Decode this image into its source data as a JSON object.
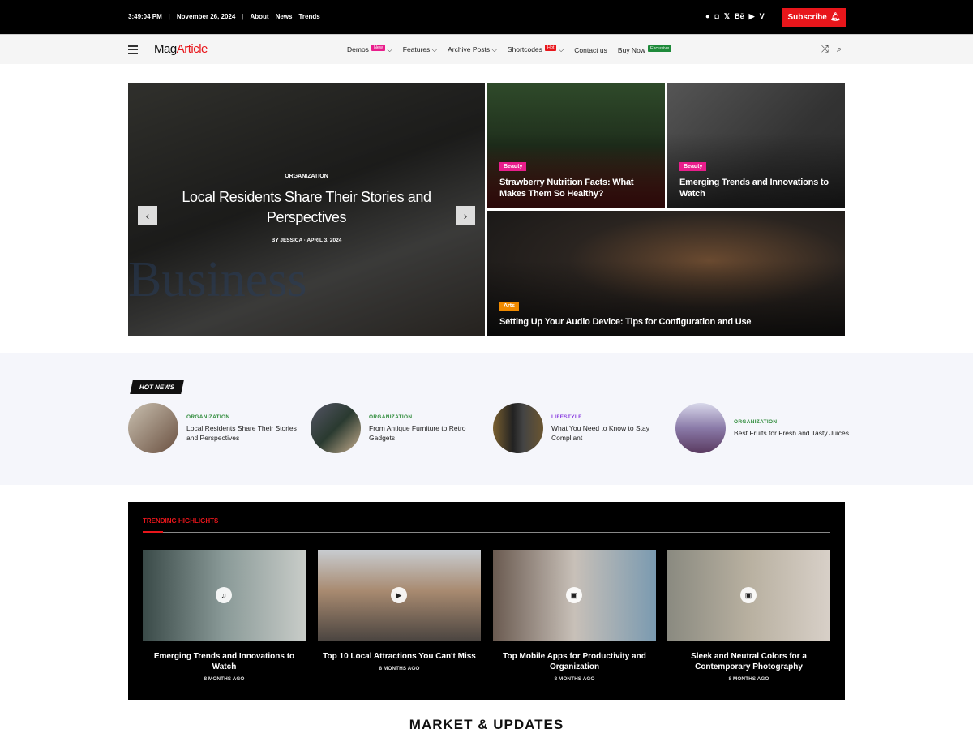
{
  "topbar": {
    "time": "3:49:04 PM",
    "date": "November 26, 2024",
    "links": [
      "About",
      "News",
      "Trends"
    ],
    "social": [
      "facebook-icon",
      "instagram-icon",
      "x-icon",
      "behance-icon",
      "youtube-icon",
      "vimeo-icon"
    ],
    "subscribe": "Subscribe"
  },
  "nav": {
    "logo_a": "Mag",
    "logo_b": "Article",
    "items": [
      {
        "label": "Demos",
        "badge": "New",
        "badge_color": "#e91e8c",
        "dropdown": true
      },
      {
        "label": "Features",
        "dropdown": true
      },
      {
        "label": "Archive Posts",
        "dropdown": true
      },
      {
        "label": "Shortcodes",
        "badge": "Hot",
        "badge_color": "#e8161b",
        "dropdown": true
      },
      {
        "label": "Contact us"
      },
      {
        "label": "Buy Now",
        "badge": "Exclusive",
        "badge_color": "#1e8a3a"
      }
    ]
  },
  "hero": {
    "main": {
      "category": "ORGANIZATION",
      "title": "Local Residents Share Their Stories and Perspectives",
      "by": "BY",
      "author": "JESSICA",
      "date": "APRIL 3, 2024"
    },
    "tiles": [
      {
        "category": "Beauty",
        "category_color": "#e91e8c",
        "title": "Strawberry Nutrition Facts: What Makes Them So Healthy?"
      },
      {
        "category": "Beauty",
        "category_color": "#e91e8c",
        "title": "Emerging Trends and Innovations to Watch"
      },
      {
        "category": "Arts",
        "category_color": "#f08a00",
        "title": "Setting Up Your Audio Device: Tips for Configuration and Use"
      }
    ]
  },
  "hot_news": {
    "label": "HOT NEWS",
    "items": [
      {
        "category": "ORGANIZATION",
        "color": "#2e8b3a",
        "title": "Local Residents Share Their Stories and Perspectives"
      },
      {
        "category": "ORGANIZATION",
        "color": "#2e8b3a",
        "title": "From Antique Furniture to Retro Gadgets"
      },
      {
        "category": "LIFESTYLE",
        "color": "#8a3fe0",
        "title": "What You Need to Know to Stay Compliant"
      },
      {
        "category": "ORGANIZATION",
        "color": "#2e8b3a",
        "title": "Best Fruits for Fresh and Tasty Juices"
      }
    ]
  },
  "trending": {
    "title": "TRENDING HIGHLIGHTS",
    "items": [
      {
        "title": "Emerging Trends and Innovations to Watch",
        "date": "8 MONTHS AGO",
        "icon": "music-icon"
      },
      {
        "title": "Top 10 Local Attractions You Can't Miss",
        "date": "8 MONTHS AGO",
        "icon": "play-icon"
      },
      {
        "title": "Top Mobile Apps for Productivity and Organization",
        "date": "8 MONTHS AGO",
        "icon": "gallery-icon"
      },
      {
        "title": "Sleek and Neutral Colors for a Contemporary Photography",
        "date": "8 MONTHS AGO",
        "icon": "gallery-icon"
      }
    ]
  },
  "market": {
    "title": "MARKET & UPDATES"
  }
}
